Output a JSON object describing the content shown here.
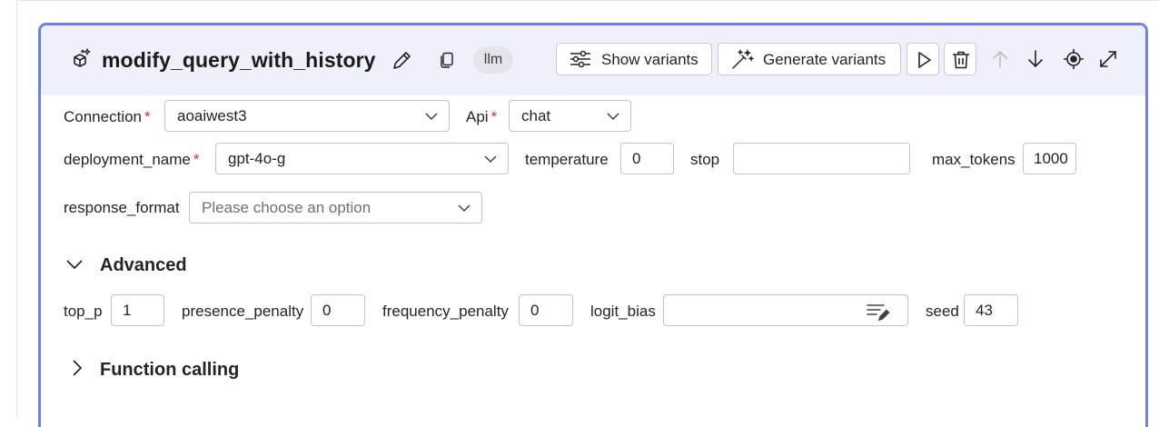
{
  "node": {
    "title": "modify_query_with_history",
    "tag": "llm",
    "buttons": {
      "show_variants": "Show variants",
      "generate_variants": "Generate variants"
    }
  },
  "fields": {
    "connection": {
      "label": "Connection",
      "required": "*",
      "value": "aoaiwest3"
    },
    "api": {
      "label": "Api",
      "required": "*",
      "value": "chat"
    },
    "deployment_name": {
      "label": "deployment_name",
      "required": "*",
      "value": "gpt-4o-g"
    },
    "temperature": {
      "label": "temperature",
      "value": "0"
    },
    "stop": {
      "label": "stop",
      "value": ""
    },
    "max_tokens": {
      "label": "max_tokens",
      "value": "1000"
    },
    "response_format": {
      "label": "response_format",
      "placeholder": "Please choose an option"
    }
  },
  "advanced": {
    "title": "Advanced",
    "top_p": {
      "label": "top_p",
      "value": "1"
    },
    "presence_penalty": {
      "label": "presence_penalty",
      "value": "0"
    },
    "frequency_penalty": {
      "label": "frequency_penalty",
      "value": "0"
    },
    "logit_bias": {
      "label": "logit_bias",
      "value": ""
    },
    "seed": {
      "label": "seed",
      "value": "43"
    }
  },
  "function_calling": {
    "title": "Function calling"
  },
  "colors": {
    "accent": "#6f7fe6",
    "header_bg": "#eef0fb",
    "required": "#c4314b"
  },
  "icons": {
    "node_type": "sparkle-cube-icon",
    "edit": "pencil-icon",
    "copy": "copy-icon",
    "show_variants": "sliders-icon",
    "generate_variants": "magic-wand-icon",
    "run": "play-icon",
    "delete": "trash-icon",
    "move_up": "arrow-up-icon",
    "move_down": "arrow-down-icon",
    "locate": "target-icon",
    "expand": "expand-icon"
  }
}
